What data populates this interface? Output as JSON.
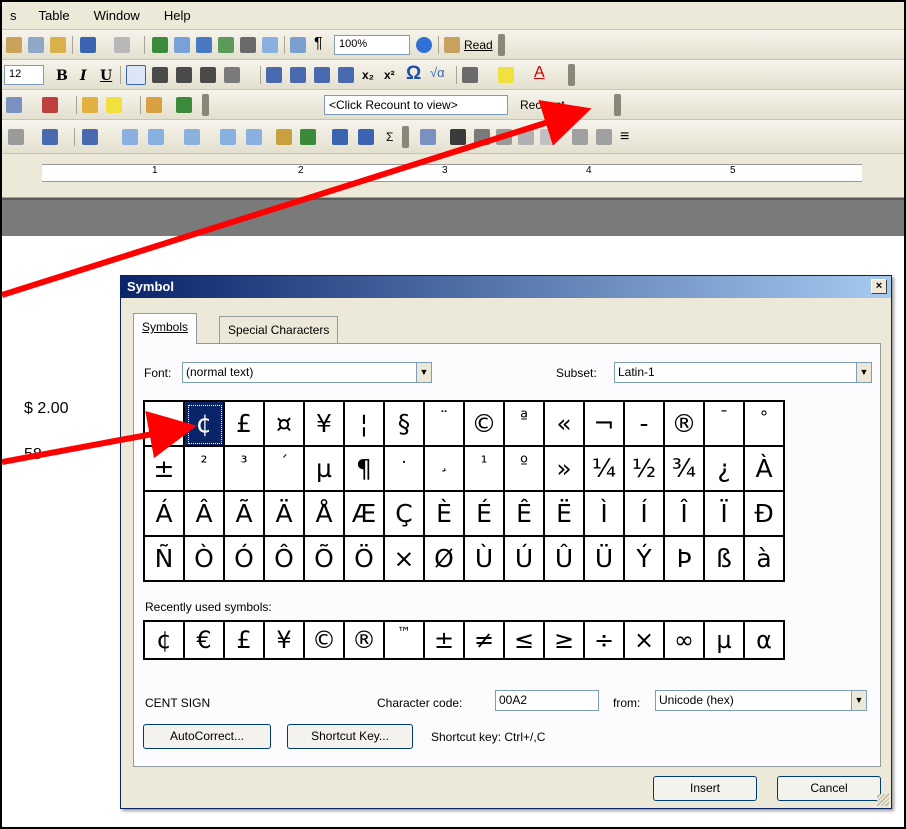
{
  "menu": [
    "s",
    "Table",
    "Window",
    "Help"
  ],
  "toolbar": {
    "zoom": "100%",
    "read": "Read",
    "font_size": "12",
    "recount_box": "<Click Recount to view>",
    "recount_btn": "Recount"
  },
  "ruler": [
    "1",
    "2",
    "3",
    "4",
    "5"
  ],
  "document": {
    "price": "$ 2.00",
    "partial": "58"
  },
  "dialog": {
    "title": "Symbol",
    "close": "×",
    "tabs": [
      "Symbols",
      "Special Characters"
    ],
    "font_label": "Font:",
    "font_value": "(normal text)",
    "subset_label": "Subset:",
    "subset_value": "Latin-1",
    "rows": [
      [
        "¡",
        "¢",
        "£",
        "¤",
        "¥",
        "¦",
        "§",
        "¨",
        "©",
        "ª",
        "«",
        "¬",
        "-",
        "®",
        "¯",
        "°"
      ],
      [
        "±",
        "²",
        "³",
        "´",
        "µ",
        "¶",
        "·",
        "¸",
        "¹",
        "º",
        "»",
        "¼",
        "½",
        "¾",
        "¿",
        "À"
      ],
      [
        "Á",
        "Â",
        "Ã",
        "Ä",
        "Å",
        "Æ",
        "Ç",
        "È",
        "É",
        "Ê",
        "Ë",
        "Ì",
        "Í",
        "Î",
        "Ï",
        "Ð"
      ],
      [
        "Ñ",
        "Ò",
        "Ó",
        "Ô",
        "Õ",
        "Ö",
        "×",
        "Ø",
        "Ù",
        "Ú",
        "Û",
        "Ü",
        "Ý",
        "Þ",
        "ß",
        "à"
      ]
    ],
    "recent_label": "Recently used symbols:",
    "recent": [
      "¢",
      "€",
      "£",
      "¥",
      "©",
      "®",
      "™",
      "±",
      "≠",
      "≤",
      "≥",
      "÷",
      "×",
      "∞",
      "µ",
      "α"
    ],
    "char_name": "CENT SIGN",
    "char_code_label": "Character code:",
    "char_code": "00A2",
    "from_label": "from:",
    "from_value": "Unicode (hex)",
    "autocorrect": "AutoCorrect...",
    "shortcut_key": "Shortcut Key...",
    "shortcut_text": "Shortcut key: Ctrl+/,C",
    "insert": "Insert",
    "cancel": "Cancel"
  },
  "colors": {
    "title_start": "#0a246a",
    "title_end": "#a6caf0",
    "arrow": "#ff0000",
    "selected": "#0a246a"
  }
}
